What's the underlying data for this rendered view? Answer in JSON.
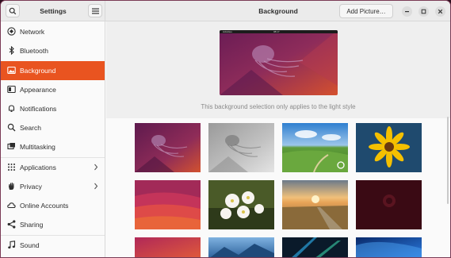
{
  "window": {
    "app_title": "Settings",
    "page_title": "Background",
    "add_button_label": "Add Picture…"
  },
  "sidebar": {
    "items": [
      {
        "label": "Network",
        "icon": "network-icon",
        "active": false,
        "chevron": false
      },
      {
        "label": "Bluetooth",
        "icon": "bluetooth-icon",
        "active": false,
        "chevron": false
      },
      {
        "label": "Background",
        "icon": "background-icon",
        "active": true,
        "chevron": false
      },
      {
        "label": "Appearance",
        "icon": "appearance-icon",
        "active": false,
        "chevron": false
      },
      {
        "label": "Notifications",
        "icon": "bell-icon",
        "active": false,
        "chevron": false
      },
      {
        "label": "Search",
        "icon": "search-icon",
        "active": false,
        "chevron": false
      },
      {
        "label": "Multitasking",
        "icon": "multitasking-icon",
        "active": false,
        "chevron": false
      },
      {
        "label": "Applications",
        "icon": "apps-grid-icon",
        "active": false,
        "chevron": true
      },
      {
        "label": "Privacy",
        "icon": "hand-icon",
        "active": false,
        "chevron": true
      },
      {
        "label": "Online Accounts",
        "icon": "cloud-icon",
        "active": false,
        "chevron": false
      },
      {
        "label": "Sharing",
        "icon": "share-icon",
        "active": false,
        "chevron": false
      },
      {
        "label": "Sound",
        "icon": "music-note-icon",
        "active": false,
        "chevron": false
      }
    ]
  },
  "main": {
    "preview": {
      "topbar_left": "Activities",
      "topbar_clock": "08:17"
    },
    "caption": "This background selection only applies to the light style",
    "wallpapers": [
      {
        "name": "jellyfish-purple",
        "selected": false
      },
      {
        "name": "jellyfish-grey",
        "selected": false
      },
      {
        "name": "green-hills",
        "selected": true
      },
      {
        "name": "yellow-flower",
        "selected": false
      },
      {
        "name": "pink-waves",
        "selected": false
      },
      {
        "name": "white-blossoms",
        "selected": false
      },
      {
        "name": "sunset-road",
        "selected": false
      },
      {
        "name": "dark-red",
        "selected": false
      },
      {
        "name": "magenta-gradient",
        "selected": false
      },
      {
        "name": "blue-mountains",
        "selected": false
      },
      {
        "name": "dark-blue-lights",
        "selected": false
      },
      {
        "name": "blue-abstract",
        "selected": false
      }
    ]
  },
  "colors": {
    "accent": "#e95420",
    "sidebar_bg": "#fafafa",
    "header_bg": "#ebebeb"
  }
}
